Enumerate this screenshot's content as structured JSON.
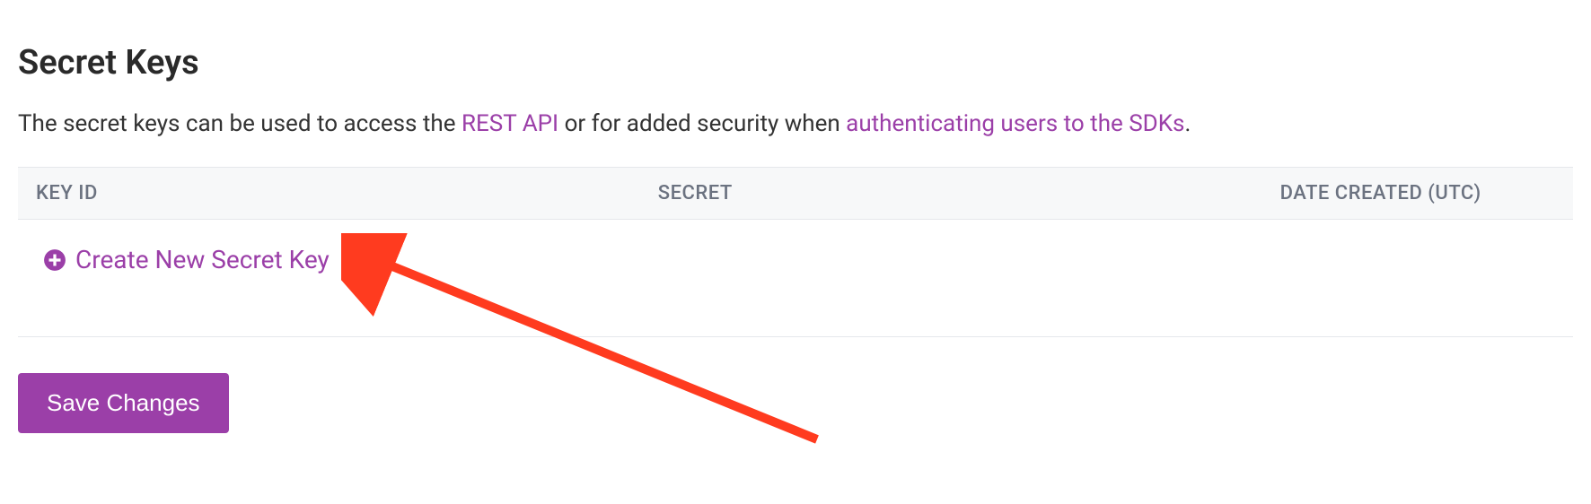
{
  "header": {
    "title": "Secret Keys"
  },
  "description": {
    "prefix": "The secret keys can be used to access the ",
    "link1": "REST API",
    "middle": " or for added security when ",
    "link2": "authenticating users to the SDKs",
    "suffix": "."
  },
  "table": {
    "columns": {
      "key_id": "KEY ID",
      "secret": "SECRET",
      "date_created": "DATE CREATED (UTC)"
    },
    "create_label": "Create New Secret Key"
  },
  "actions": {
    "save_label": "Save Changes"
  },
  "annotation": {
    "type": "arrow",
    "color": "#ff3b1f"
  }
}
